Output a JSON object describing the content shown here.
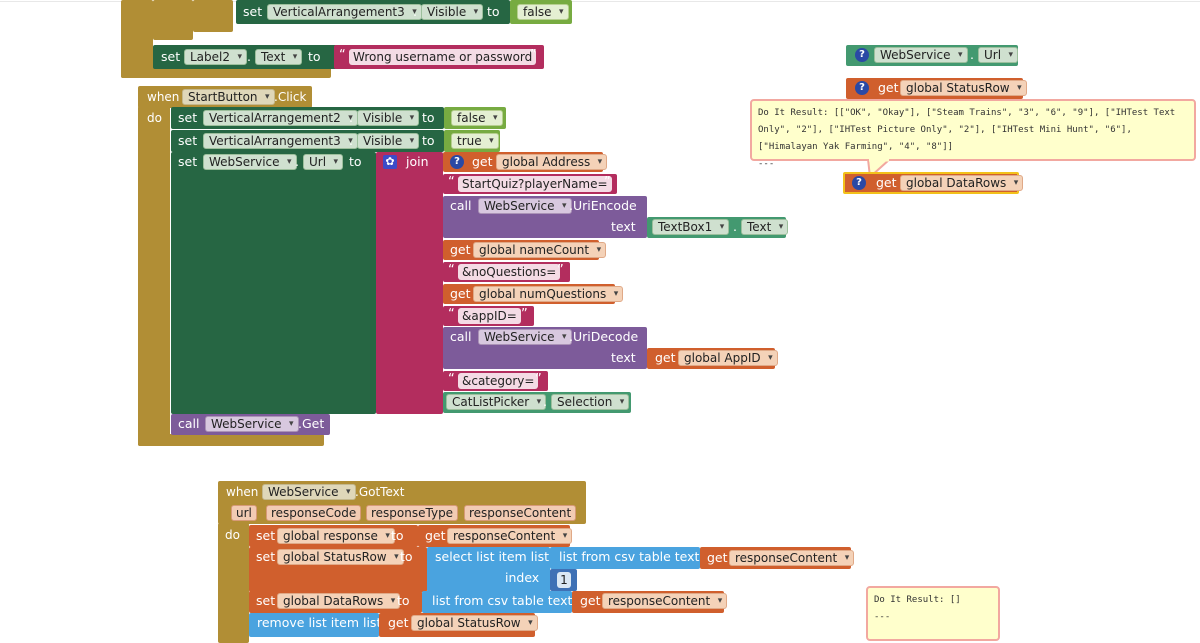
{
  "kw": {
    "set": "set",
    "to": "to",
    "when": "when",
    "do": "do",
    "call": "call",
    "get": "get",
    "join": "join",
    "text": "text",
    "index": "index",
    "dot": "."
  },
  "top_fragment": {
    "component": "VerticalArrangement3",
    "property": "Visible",
    "value": "false"
  },
  "label_block": {
    "component": "Label2",
    "property": "Text",
    "string": "Wrong username or password"
  },
  "start_click": {
    "component": "StartButton",
    "event": ".Click",
    "set1": {
      "component": "VerticalArrangement2",
      "property": "Visible",
      "value": "false"
    },
    "set2": {
      "component": "VerticalArrangement3",
      "property": "Visible",
      "value": "true"
    },
    "set3": {
      "component": "WebService",
      "property": "Url"
    },
    "join_items": {
      "g_address": "global Address",
      "s_startquiz": "StartQuiz?playerName=",
      "uriencode_component": "WebService",
      "uriencode_method": ".UriEncode",
      "textbox": "TextBox1",
      "textbox_prop": "Text",
      "g_namecount": "global nameCount",
      "s_noquestions": "&noQuestions=",
      "g_numquestions": "global numQuestions",
      "s_appid": "&appID=",
      "uridecode_component": "WebService",
      "uridecode_method": ".UriDecode",
      "g_appid": "global AppID",
      "s_category": "&category=",
      "catpicker": "CatListPicker",
      "catpicker_prop": "Selection"
    },
    "call_get_component": "WebService",
    "call_get_method": ".Get"
  },
  "floating": {
    "webservice_url_component": "WebService",
    "webservice_url_prop": "Url",
    "g_statusrow": "global StatusRow",
    "g_datarows": "global DataRows",
    "result1": "Do It Result: [[\"OK\", \"Okay\"], [\"Steam Trains\", \"3\", \"6\", \"9\"], [\"IHTest Text Only\", \"2\"], [\"IHTest Picture Only\", \"2\"], [\"IHTest Mini Hunt\", \"6\"], [\"Himalayan Yak Farming\", \"4\", \"8\"]]",
    "result1_sep": "---",
    "result2": "Do It Result: []",
    "result2_sep": "---"
  },
  "gottext": {
    "component": "WebService",
    "event": ".GotText",
    "params": [
      "url",
      "responseCode",
      "responseType",
      "responseContent"
    ],
    "set_response_var": "global response",
    "get_responsecontent": "responseContent",
    "set_statusrow_var": "global StatusRow",
    "select_list_item": "select list item  list",
    "list_from_csv_table": "list from csv table  text",
    "index_value": "1",
    "set_datarows_var": "global DataRows",
    "remove_list_item": "remove list item  list",
    "g_statusrow": "global StatusRow"
  },
  "colors": {
    "event_block": "#b18e35",
    "component_set": "#266643",
    "text_string": "#b32d5e",
    "variable": "#d05f2d",
    "call_method": "#7d5b9a",
    "list": "#4aa3df",
    "math": "#3f71b5",
    "logic": "#77ab41",
    "component_getter": "#439970"
  }
}
